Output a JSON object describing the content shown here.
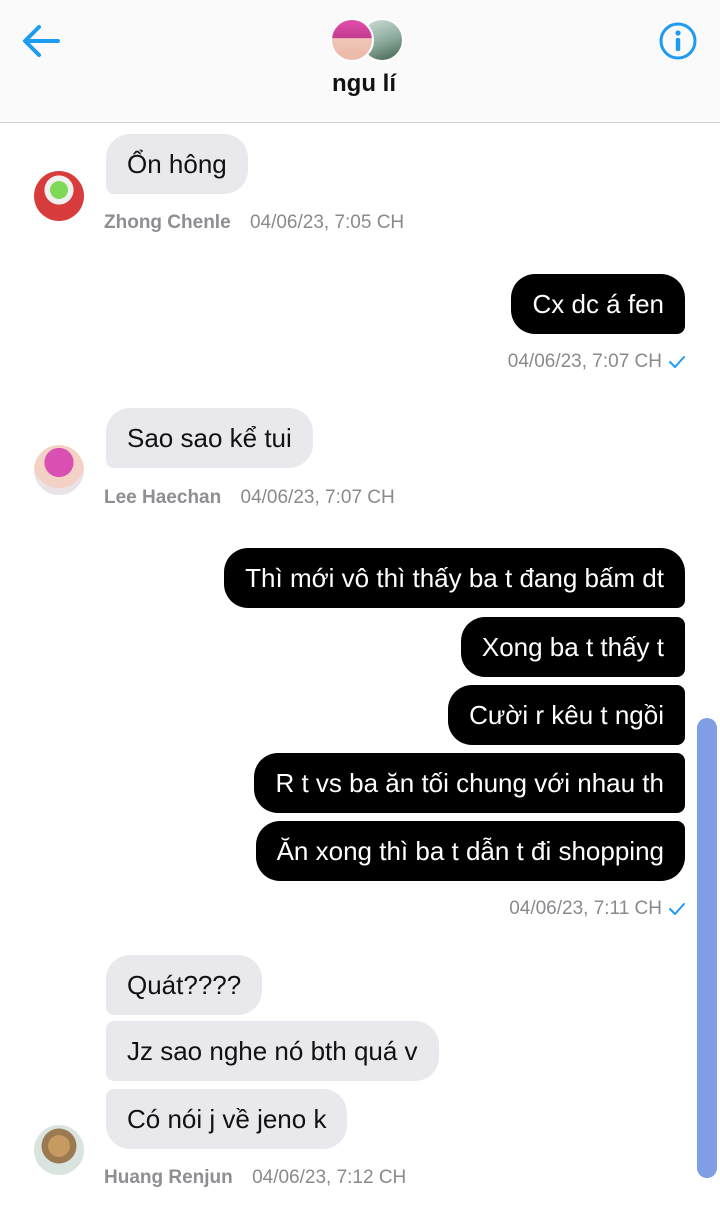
{
  "header": {
    "title": "ngu lí",
    "back_icon": "arrow-left-icon",
    "info_icon": "info-icon",
    "accent_color": "#1d9bf0"
  },
  "messages": {
    "m1": {
      "text": "Ổn hông",
      "sender": "Zhong Chenle",
      "time": "04/06/23, 7:05 CH"
    },
    "m2": {
      "text": "Cx dc á fen",
      "time": "04/06/23, 7:07 CH"
    },
    "m3": {
      "text": "Sao sao kể tui",
      "sender": "Lee Haechan",
      "time": "04/06/23, 7:07 CH"
    },
    "m4": {
      "lines": [
        "Thì mới vô thì thấy ba t đang bấm dt",
        "Xong ba t thấy t",
        "Cười r kêu t ngồi",
        "R t vs ba ăn tối chung với nhau th",
        "Ăn xong thì ba t dẫn t đi shopping"
      ],
      "time": "04/06/23, 7:11 CH"
    },
    "m5": {
      "lines": [
        "Quát????",
        "Jz sao nghe nó bth quá v",
        "Có nói j về jeno k"
      ],
      "sender": "Huang Renjun",
      "time": "04/06/23, 7:12 CH"
    }
  },
  "colors": {
    "outgoing_bubble": "#000000",
    "incoming_bubble": "#e8e8ed",
    "scrollbar": "#7f9ee3",
    "read_check": "#1d9bf0"
  }
}
